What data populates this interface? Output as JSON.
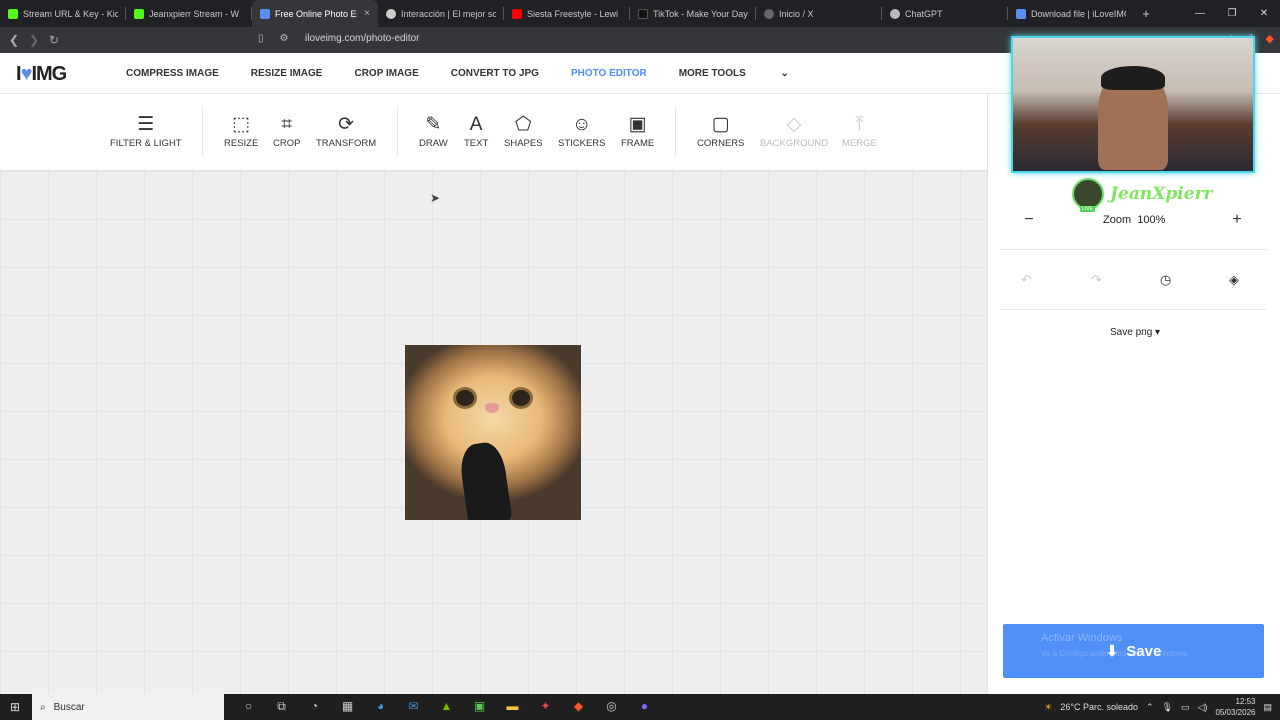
{
  "browser": {
    "tabs": [
      {
        "title": "Stream URL & Key - Kick D",
        "favcolor": "#53fc18",
        "active": false
      },
      {
        "title": "Jeanxpierr Stream - W",
        "favcolor": "#53fc18",
        "active": false
      },
      {
        "title": "Free Online Photo Ed",
        "favcolor": "#5b8def",
        "active": true
      },
      {
        "title": "Interacción | El mejor soft",
        "favcolor": "#cccccc",
        "active": false
      },
      {
        "title": "Siesta Freestyle - Lewi",
        "favcolor": "#ff0000",
        "active": false
      },
      {
        "title": "TikTok - Make Your Day",
        "favcolor": "#111111",
        "active": false
      },
      {
        "title": "Inicio / X",
        "favcolor": "#666666",
        "active": false
      },
      {
        "title": "ChatGPT",
        "favcolor": "#bbbbbb",
        "active": false
      },
      {
        "title": "Download file | iLoveIMG",
        "favcolor": "#5b8def",
        "active": false
      }
    ],
    "new_tab": "+",
    "close_tab": "×",
    "url": "iloveimg.com/photo-editor"
  },
  "site": {
    "logo_i": "I",
    "logo_heart": "♥",
    "logo_img": "IMG",
    "nav": [
      "COMPRESS IMAGE",
      "RESIZE IMAGE",
      "CROP IMAGE",
      "CONVERT TO JPG",
      "PHOTO EDITOR",
      "MORE TOOLS"
    ],
    "nav_active": "PHOTO EDITOR"
  },
  "toolbar": {
    "filter": "FILTER & LIGHT",
    "resize": "RESIZE",
    "crop": "CROP",
    "transform": "TRANSFORM",
    "draw": "DRAW",
    "text": "TEXT",
    "shapes": "SHAPES",
    "stickers": "STICKERS",
    "frame": "FRAME",
    "corners": "CORNERS",
    "background": "BACKGROUND",
    "merge": "MERGE"
  },
  "panel": {
    "streamer_name": "JeanXpierr",
    "live_badge": "LIVE",
    "zoom_label": "Zoom",
    "zoom_value": "100%",
    "zoom_minus": "−",
    "zoom_plus": "+",
    "save_format": "Save png",
    "save_button": "Save",
    "activate_title": "Activar Windows",
    "activate_sub": "Ve a Configuración para activar Windows."
  },
  "taskbar": {
    "search_placeholder": "Buscar",
    "weather": "26°C  Parc. soleado",
    "time": "12:53",
    "date": "05/03/2026"
  },
  "colors": {
    "accent": "#4f8ff6",
    "webcam_border": "#4fd6e8",
    "streamer_name": "#7ee85d"
  }
}
